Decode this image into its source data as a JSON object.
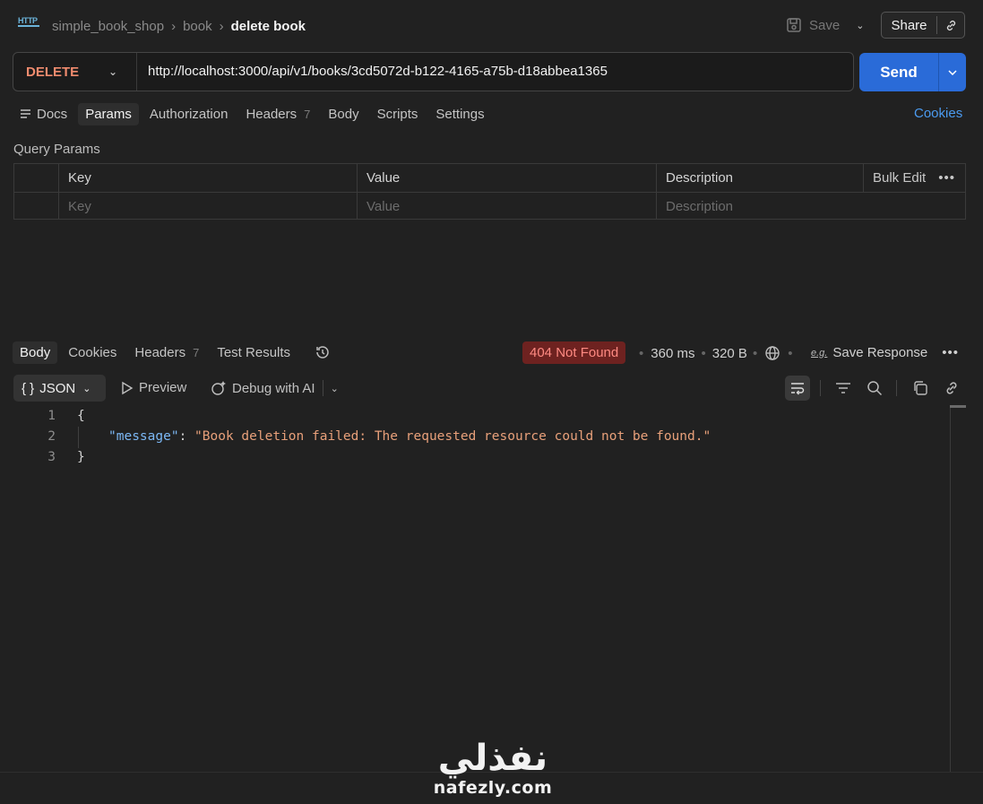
{
  "header": {
    "http_icon": "http-icon",
    "breadcrumb": [
      "simple_book_shop",
      "book",
      "delete book"
    ],
    "save_label": "Save",
    "share_label": "Share"
  },
  "request": {
    "method": "DELETE",
    "url": "http://localhost:3000/api/v1/books/3cd5072d-b122-4165-a75b-d18abbea1365",
    "send_label": "Send"
  },
  "request_tabs": [
    {
      "label": "Docs"
    },
    {
      "label": "Params",
      "active": true
    },
    {
      "label": "Authorization"
    },
    {
      "label": "Headers",
      "badge": "7"
    },
    {
      "label": "Body"
    },
    {
      "label": "Scripts"
    },
    {
      "label": "Settings"
    }
  ],
  "cookies_link": "Cookies",
  "query_params": {
    "title": "Query Params",
    "columns": [
      "Key",
      "Value",
      "Description"
    ],
    "bulk_edit": "Bulk Edit",
    "placeholders": {
      "key": "Key",
      "value": "Value",
      "description": "Description"
    }
  },
  "response": {
    "tabs": [
      {
        "label": "Body",
        "active": true
      },
      {
        "label": "Cookies"
      },
      {
        "label": "Headers",
        "badge": "7"
      },
      {
        "label": "Test Results"
      }
    ],
    "status": "404 Not Found",
    "time": "360 ms",
    "size": "320 B",
    "save_response_label": "Save Response",
    "format_label": "JSON",
    "preview_label": "Preview",
    "debug_label": "Debug with AI",
    "body_lines": [
      {
        "num": "1",
        "text": "{"
      },
      {
        "num": "2",
        "key": "\"message\"",
        "sep": ": ",
        "value": "\"Book deletion failed: The requested resource could not be found.\""
      },
      {
        "num": "3",
        "text": "}"
      }
    ]
  },
  "watermark": {
    "arabic": "نفذلي",
    "latin": "nafezly.com"
  },
  "colors": {
    "accent": "#2a6bd8",
    "error_bg": "#6e2220",
    "error_text": "#ff8a82",
    "method": "#f08b6e"
  }
}
